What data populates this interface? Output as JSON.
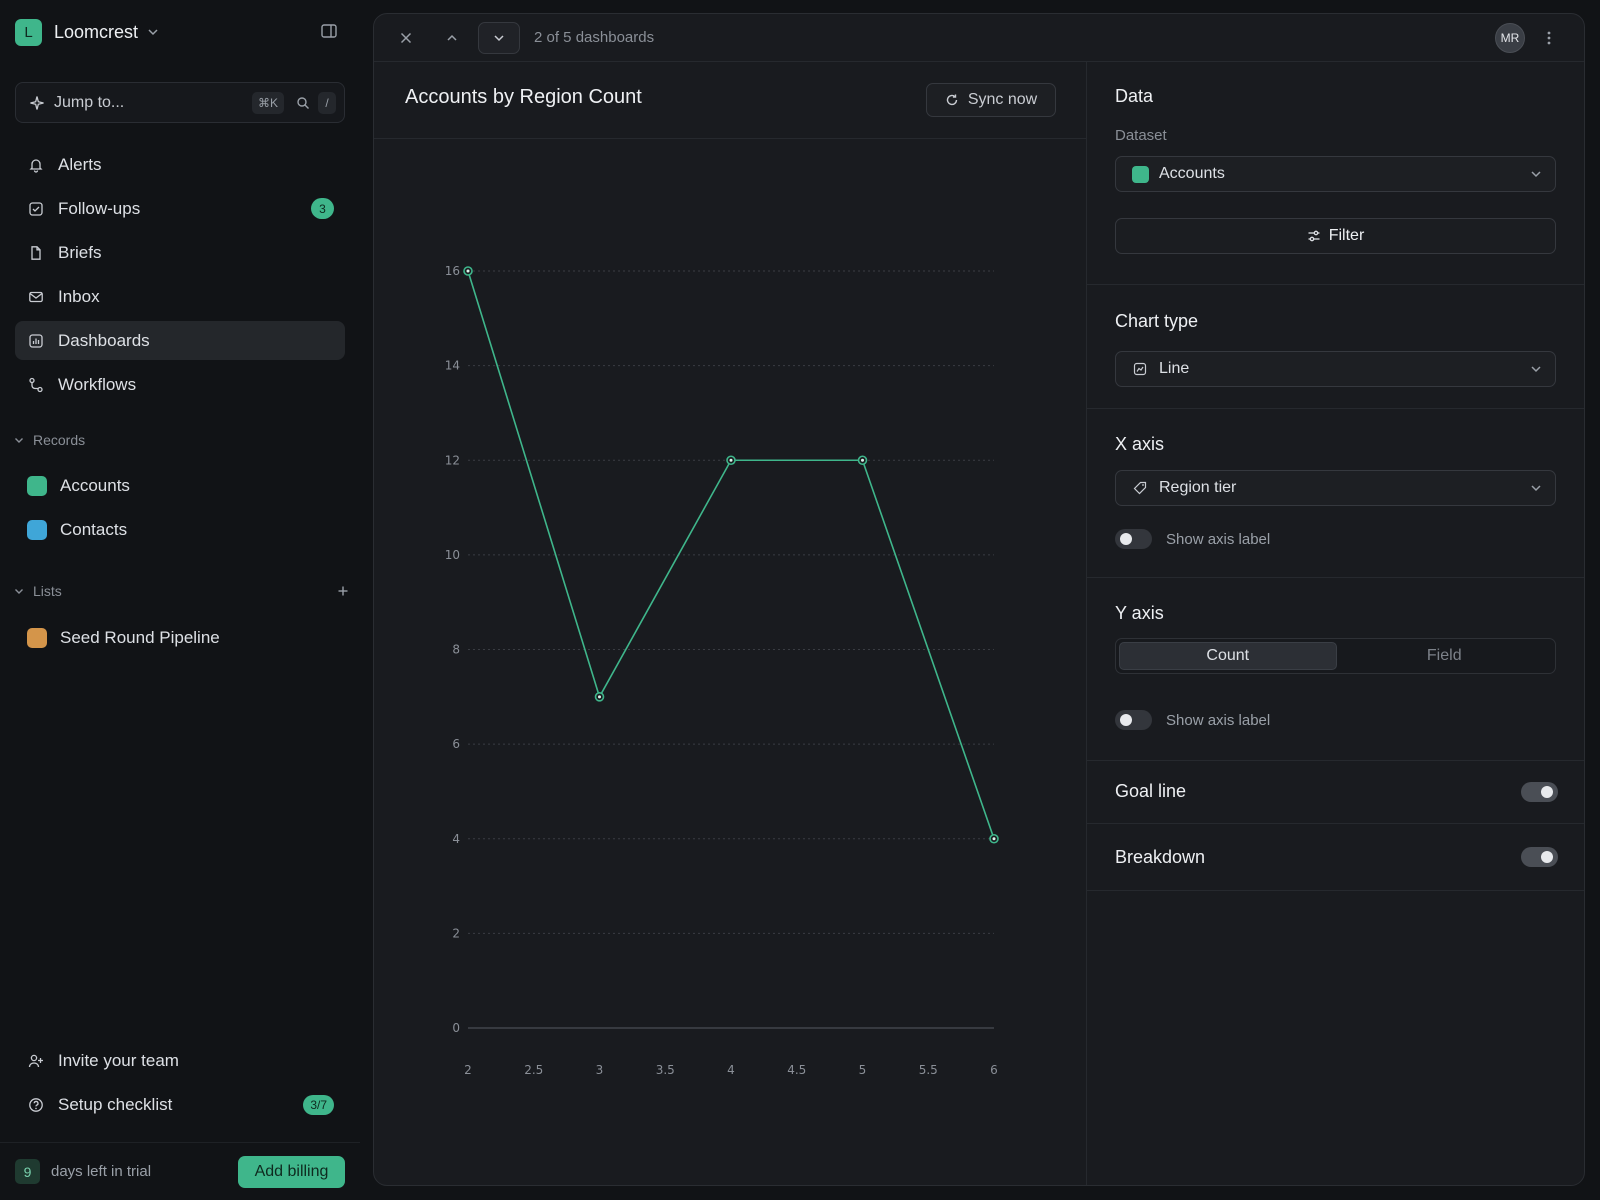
{
  "workspace": {
    "initial": "L",
    "name": "Loomcrest"
  },
  "jump": {
    "label": "Jump to...",
    "shortcut": "⌘K",
    "slash": "/"
  },
  "nav": [
    {
      "label": "Alerts",
      "icon": "bell-icon"
    },
    {
      "label": "Follow-ups",
      "icon": "check-square-icon",
      "badge": "3"
    },
    {
      "label": "Briefs",
      "icon": "file-icon"
    },
    {
      "label": "Inbox",
      "icon": "mail-icon"
    },
    {
      "label": "Dashboards",
      "icon": "chart-icon",
      "active": true
    },
    {
      "label": "Workflows",
      "icon": "workflow-icon"
    }
  ],
  "records": {
    "label": "Records",
    "items": [
      {
        "label": "Accounts",
        "color": "#3fb68b"
      },
      {
        "label": "Contacts",
        "color": "#3fa6d8"
      }
    ]
  },
  "lists": {
    "label": "Lists",
    "items": [
      {
        "label": "Seed Round Pipeline",
        "color": "#d4954a"
      }
    ]
  },
  "footer": {
    "invite": "Invite your team",
    "checklist": "Setup checklist",
    "checklist_badge": "3/7",
    "trial_days": "9",
    "trial_text": "days left in trial",
    "billing_button": "Add billing"
  },
  "topbar": {
    "counter": "2 of 5 dashboards",
    "avatar": "MR"
  },
  "chart_header": {
    "title": "Accounts by Region Count",
    "sync": "Sync now"
  },
  "chart_data": {
    "type": "line",
    "x": [
      2,
      3,
      4,
      5,
      6
    ],
    "series": [
      {
        "values": [
          16,
          7,
          12,
          12,
          4
        ],
        "color": "#3fb68b"
      }
    ],
    "xticks": [
      "2",
      "2.5",
      "3",
      "3.5",
      "4",
      "4.5",
      "5",
      "5.5",
      "6"
    ],
    "yticks": [
      "0",
      "2",
      "4",
      "6",
      "8",
      "10",
      "12",
      "14",
      "16"
    ],
    "xlim": [
      2,
      6
    ],
    "ylim": [
      0,
      16
    ],
    "grid": true
  },
  "config": {
    "data_title": "Data",
    "dataset_label": "Dataset",
    "dataset_value": "Accounts",
    "dataset_color": "#3fb68b",
    "filter_label": "Filter",
    "chart_type_title": "Chart type",
    "chart_type_value": "Line",
    "x_axis_title": "X axis",
    "x_axis_value": "Region tier",
    "x_show_label": "Show axis label",
    "y_axis_title": "Y axis",
    "y_seg_count": "Count",
    "y_seg_field": "Field",
    "y_show_label": "Show axis label",
    "goal_line": "Goal line",
    "breakdown": "Breakdown"
  }
}
